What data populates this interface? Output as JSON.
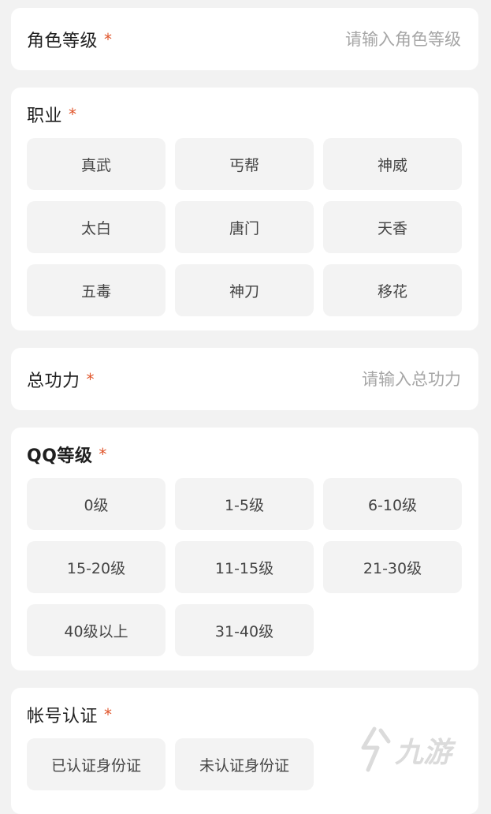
{
  "level": {
    "label": "角色等级",
    "required": "*",
    "placeholder": "请输入角色等级"
  },
  "profession": {
    "label": "职业",
    "required": "*",
    "options": [
      "真武",
      "丐帮",
      "神威",
      "太白",
      "唐门",
      "天香",
      "五毒",
      "神刀",
      "移花"
    ]
  },
  "power": {
    "label": "总功力",
    "required": "*",
    "placeholder": "请输入总功力"
  },
  "qq_level": {
    "label": "QQ等级",
    "required": "*",
    "options": [
      "0级",
      "1-5级",
      "6-10级",
      "15-20级",
      "11-15级",
      "21-30级",
      "40级以上",
      "31-40级"
    ]
  },
  "account": {
    "label": "帐号认证",
    "required": "*",
    "options": [
      "已认证身份证",
      "未认证身份证"
    ]
  },
  "colors": {
    "accent": "#e0552b",
    "option_bg": "#f3f3f3",
    "page_bg": "#f2f2f2"
  },
  "watermark": {
    "text": "九游"
  }
}
